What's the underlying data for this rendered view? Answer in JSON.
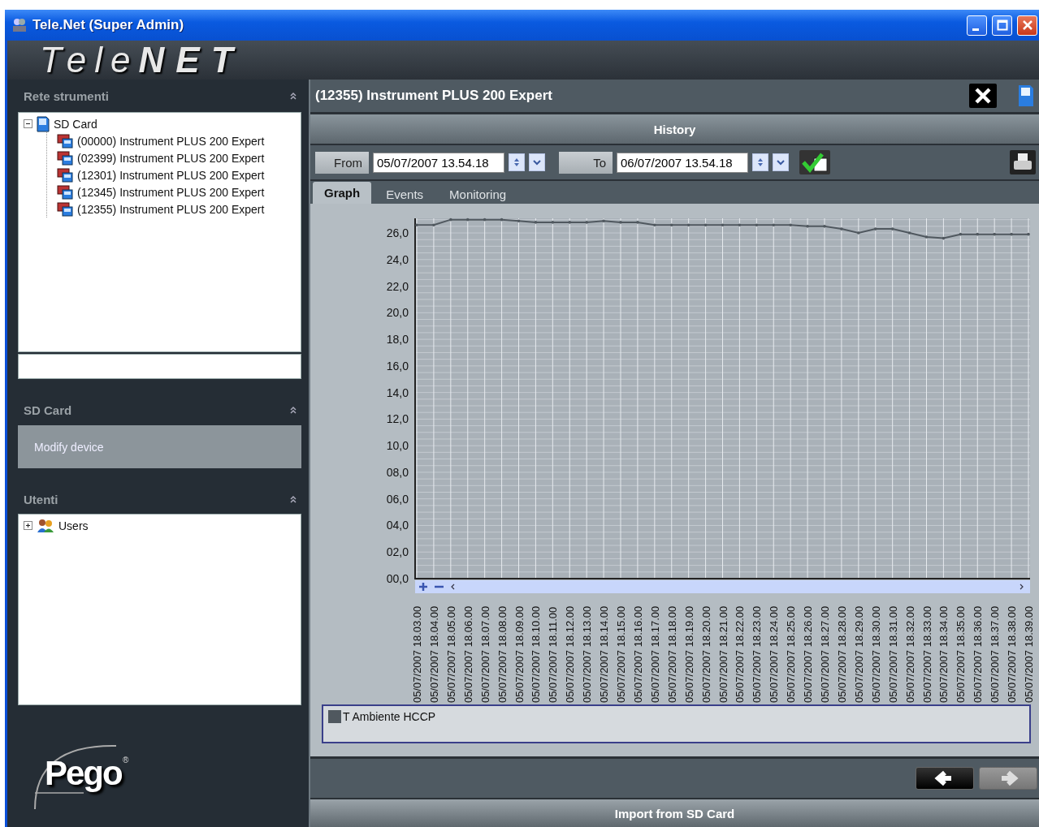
{
  "window": {
    "title": "Tele.Net (Super Admin)"
  },
  "logo": {
    "light": "Tele",
    "bold": "NET"
  },
  "sidebar": {
    "sections": [
      {
        "kind": "tree",
        "title": "Rete strumenti",
        "has_field": true,
        "tree": [
          {
            "label": "SD Card",
            "kind": "card",
            "expanded": true,
            "children": [
              {
                "label": "(00000) Instrument PLUS 200 Expert",
                "kind": "instrument"
              },
              {
                "label": "(02399) Instrument PLUS 200 Expert",
                "kind": "instrument"
              },
              {
                "label": "(12301) Instrument PLUS 200 Expert",
                "kind": "instrument"
              },
              {
                "label": "(12345) Instrument PLUS 200 Expert",
                "kind": "instrument"
              },
              {
                "label": "(12355) Instrument PLUS 200 Expert",
                "kind": "instrument"
              }
            ]
          }
        ]
      },
      {
        "kind": "actions",
        "title": "SD Card",
        "items": [
          {
            "label": "Modify device"
          }
        ]
      },
      {
        "kind": "tree",
        "title": "Utenti",
        "has_field": false,
        "tree": [
          {
            "label": "Users",
            "kind": "users",
            "expanded": false
          }
        ]
      }
    ]
  },
  "brand": {
    "name": "Pego",
    "mark": "®"
  },
  "device": {
    "title": "(12355) Instrument PLUS 200 Expert"
  },
  "panel": {
    "title": "History"
  },
  "range": {
    "from_label": "From",
    "from_value": "05/07/2007 13.54.18",
    "to_label": "To",
    "to_value": "06/07/2007 13.54.18"
  },
  "tabs": [
    {
      "label": "Graph",
      "selected": true
    },
    {
      "label": "Events",
      "selected": false
    },
    {
      "label": "Monitoring",
      "selected": false
    }
  ],
  "chart_data": {
    "type": "line",
    "categories": [
      "05/07/2007 18.03.00",
      "05/07/2007 18.04.00",
      "05/07/2007 18.05.00",
      "05/07/2007 18.06.00",
      "05/07/2007 18.07.00",
      "05/07/2007 18.08.00",
      "05/07/2007 18.09.00",
      "05/07/2007 18.10.00",
      "05/07/2007 18.11.00",
      "05/07/2007 18.12.00",
      "05/07/2007 18.13.00",
      "05/07/2007 18.14.00",
      "05/07/2007 18.15.00",
      "05/07/2007 18.16.00",
      "05/07/2007 18.17.00",
      "05/07/2007 18.18.00",
      "05/07/2007 18.19.00",
      "05/07/2007 18.20.00",
      "05/07/2007 18.21.00",
      "05/07/2007 18.22.00",
      "05/07/2007 18.23.00",
      "05/07/2007 18.24.00",
      "05/07/2007 18.25.00",
      "05/07/2007 18.26.00",
      "05/07/2007 18.27.00",
      "05/07/2007 18.28.00",
      "05/07/2007 18.29.00",
      "05/07/2007 18.30.00",
      "05/07/2007 18.31.00",
      "05/07/2007 18.32.00",
      "05/07/2007 18.33.00",
      "05/07/2007 18.34.00",
      "05/07/2007 18.35.00",
      "05/07/2007 18.36.00",
      "05/07/2007 18.37.00",
      "05/07/2007 18.38.00",
      "05/07/2007 18.39.00"
    ],
    "series": [
      {
        "name": "T Ambiente HCCP",
        "color": "#50585f",
        "values": [
          26.6,
          26.6,
          27.0,
          27.0,
          27.0,
          27.0,
          26.9,
          26.8,
          26.8,
          26.8,
          26.8,
          26.9,
          26.8,
          26.8,
          26.6,
          26.6,
          26.6,
          26.6,
          26.6,
          26.6,
          26.6,
          26.6,
          26.6,
          26.5,
          26.5,
          26.3,
          26.0,
          26.3,
          26.3,
          26.0,
          25.7,
          25.6,
          25.9,
          25.9,
          25.9,
          25.9,
          25.9
        ]
      }
    ],
    "ylim": [
      0,
      27.1
    ],
    "grid": true,
    "yticks": [
      {
        "value": 0,
        "label": "00,0"
      },
      {
        "value": 2,
        "label": "02,0"
      },
      {
        "value": 4,
        "label": "04,0"
      },
      {
        "value": 6,
        "label": "06,0"
      },
      {
        "value": 8,
        "label": "08,0"
      },
      {
        "value": 10,
        "label": "10,0"
      },
      {
        "value": 12,
        "label": "12,0"
      },
      {
        "value": 14,
        "label": "14,0"
      },
      {
        "value": 16,
        "label": "16,0"
      },
      {
        "value": 18,
        "label": "18,0"
      },
      {
        "value": 20,
        "label": "20,0"
      },
      {
        "value": 22,
        "label": "22,0"
      },
      {
        "value": 24,
        "label": "24,0"
      },
      {
        "value": 26,
        "label": "26,0"
      }
    ]
  },
  "nav": [
    {
      "kind": "back",
      "disabled": false
    },
    {
      "kind": "forward",
      "disabled": true
    }
  ],
  "footer": {
    "label": "Import from SD Card"
  }
}
